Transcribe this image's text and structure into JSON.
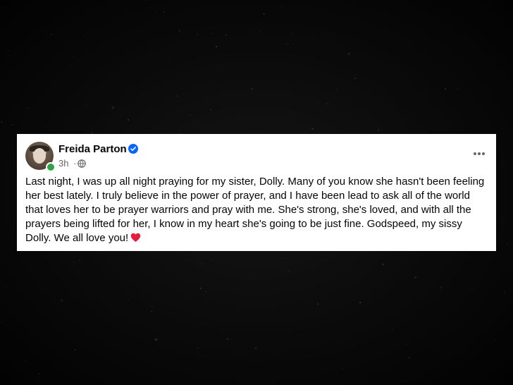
{
  "post": {
    "author": "Freida Parton",
    "verified": true,
    "timestamp": "3h",
    "separator": "·",
    "privacy_icon": "globe-icon",
    "more_icon": "more-options-icon",
    "text": "Last night, I was up all night praying for my sister, Dolly. Many of you know she hasn't been feeling her best lately. I truly believe in the power of prayer, and I have been lead to ask all of the world that loves her to be prayer warriors and pray with me. She's strong, she's loved, and with all the prayers being lifted for her, I know in my heart she's going to be just fine. Godspeed, my sissy Dolly. We all love you!",
    "emoji": "heart-icon"
  },
  "colors": {
    "card_bg": "#ffffff",
    "text_primary": "#050505",
    "text_secondary": "#65676b",
    "verified_blue": "#0866ff",
    "online_green": "#31a24c",
    "heart_red": "#e41e3f",
    "page_bg": "#070707"
  }
}
